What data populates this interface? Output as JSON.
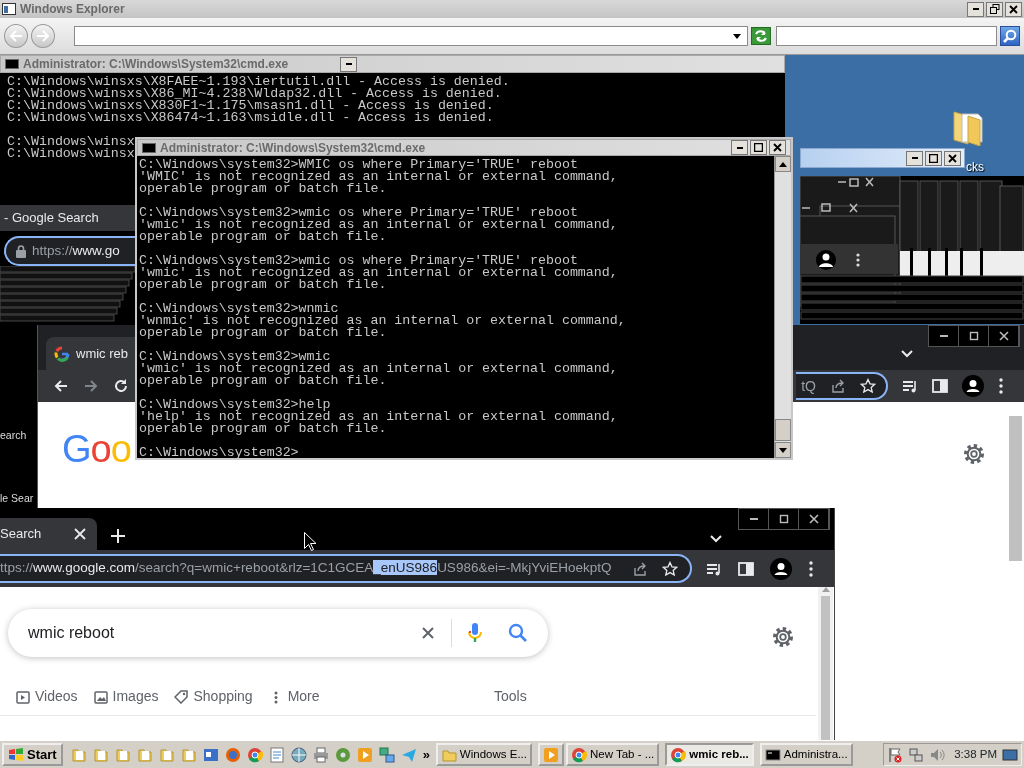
{
  "explorer_window": {
    "title": "Windows Explorer"
  },
  "back_console": {
    "title": "Administrator: C:\\Windows\\System32\\cmd.exe",
    "lines": [
      "C:\\Windows\\winsxs\\X8FAEE~1.193\\iertutil.dll - Access is denied.",
      "C:\\Windows\\winsxs\\X86_MI~4.238\\Wldap32.dll - Access is denied.",
      "C:\\Windows\\winsxs\\X830F1~1.175\\msasn1.dll - Access is denied.",
      "C:\\Windows\\winsxs\\X86474~1.163\\msidle.dll - Access is denied."
    ],
    "cut_lines": [
      "C:\\Windows\\winsx",
      "C:\\Windows\\winsx"
    ]
  },
  "desktop_icon": {
    "label": "cks"
  },
  "left_browser": {
    "tab_title": "- Google Search",
    "url_scheme": "https://",
    "url_host": "www.go",
    "fragments": [
      "earch",
      "le Sear"
    ]
  },
  "middle_browser": {
    "tab_title": "wmic reb",
    "url_tail": "tQ",
    "logo": "Goo"
  },
  "front_console": {
    "title": "Administrator: C:\\Windows\\System32\\cmd.exe",
    "blocks": [
      {
        "command": "C:\\Windows\\system32>WMIC os where Primary='TRUE' reboot",
        "output": [
          "'WMIC' is not recognized as an internal or external command,",
          "operable program or batch file."
        ]
      },
      {
        "command": "C:\\Windows\\system32>wmic os where Primary='TRUE' reboot",
        "output": [
          "'wmic' is not recognized as an internal or external command,",
          "operable program or batch file."
        ]
      },
      {
        "command": "C:\\Windows\\system32>wmic os where Primary='TRUE' reboot",
        "output": [
          "'wmic' is not recognized as an internal or external command,",
          "operable program or batch file."
        ]
      },
      {
        "command": "C:\\Windows\\system32>wnmic",
        "output": [
          "'wnmic' is not recognized as an internal or external command,",
          "operable program or batch file."
        ]
      },
      {
        "command": "C:\\Windows\\system32>wmic",
        "output": [
          "'wmic' is not recognized as an internal or external command,",
          "operable program or batch file."
        ]
      },
      {
        "command": "C:\\Windows\\system32>help",
        "output": [
          "'help' is not recognized as an internal or external command,",
          "operable program or batch file."
        ]
      }
    ],
    "prompt": "C:\\Windows\\system32>"
  },
  "front_browser": {
    "tab_title": "Search",
    "url": {
      "scheme": "ttps://",
      "host": "www.google.com",
      "before": "/search?q=wmic+reboot&rlz=1C1GCEA",
      "selection": "_enUS986",
      "after": "US986&ei=-MkjYviEHoekptQ"
    },
    "search_query": "wmic reboot",
    "filters": [
      "Videos",
      "Images",
      "Shopping",
      "More"
    ],
    "tools": "Tools"
  },
  "taskbar": {
    "start": "Start",
    "overflow": "»",
    "tasks": [
      {
        "kind": "labeled",
        "label": "Windows E...",
        "selected": false
      },
      {
        "kind": "icon-only",
        "selected": false
      },
      {
        "kind": "labeled",
        "label": "New Tab - ...",
        "selected": false
      },
      {
        "kind": "labeled",
        "label": "wmic reb...",
        "selected": true
      },
      {
        "kind": "labeled",
        "label": "Administra...",
        "selected": false
      }
    ],
    "clock": "3:38 PM"
  }
}
